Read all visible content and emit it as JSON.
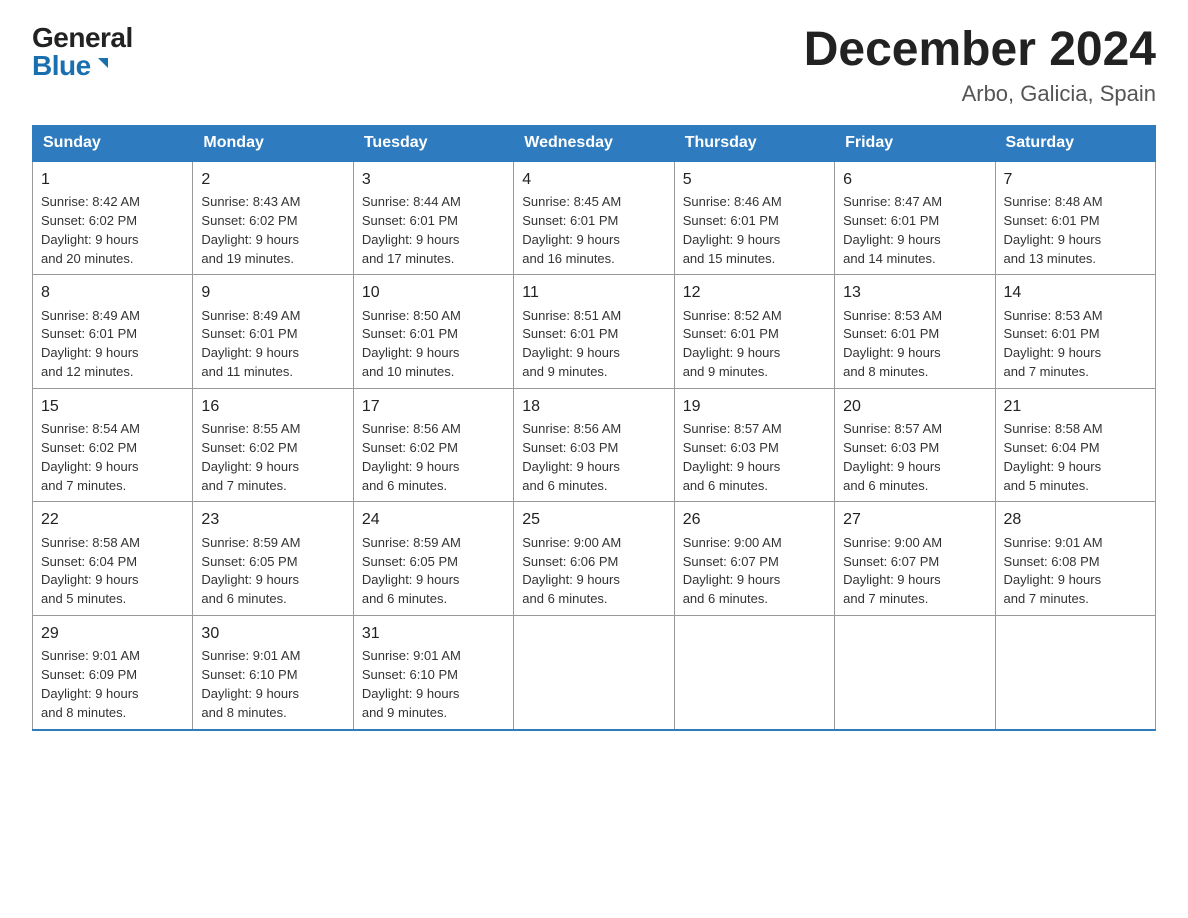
{
  "logo": {
    "general": "General",
    "blue": "Blue"
  },
  "title": "December 2024",
  "subtitle": "Arbo, Galicia, Spain",
  "days_of_week": [
    "Sunday",
    "Monday",
    "Tuesday",
    "Wednesday",
    "Thursday",
    "Friday",
    "Saturday"
  ],
  "weeks": [
    [
      {
        "day": "1",
        "info": "Sunrise: 8:42 AM\nSunset: 6:02 PM\nDaylight: 9 hours\nand 20 minutes."
      },
      {
        "day": "2",
        "info": "Sunrise: 8:43 AM\nSunset: 6:02 PM\nDaylight: 9 hours\nand 19 minutes."
      },
      {
        "day": "3",
        "info": "Sunrise: 8:44 AM\nSunset: 6:01 PM\nDaylight: 9 hours\nand 17 minutes."
      },
      {
        "day": "4",
        "info": "Sunrise: 8:45 AM\nSunset: 6:01 PM\nDaylight: 9 hours\nand 16 minutes."
      },
      {
        "day": "5",
        "info": "Sunrise: 8:46 AM\nSunset: 6:01 PM\nDaylight: 9 hours\nand 15 minutes."
      },
      {
        "day": "6",
        "info": "Sunrise: 8:47 AM\nSunset: 6:01 PM\nDaylight: 9 hours\nand 14 minutes."
      },
      {
        "day": "7",
        "info": "Sunrise: 8:48 AM\nSunset: 6:01 PM\nDaylight: 9 hours\nand 13 minutes."
      }
    ],
    [
      {
        "day": "8",
        "info": "Sunrise: 8:49 AM\nSunset: 6:01 PM\nDaylight: 9 hours\nand 12 minutes."
      },
      {
        "day": "9",
        "info": "Sunrise: 8:49 AM\nSunset: 6:01 PM\nDaylight: 9 hours\nand 11 minutes."
      },
      {
        "day": "10",
        "info": "Sunrise: 8:50 AM\nSunset: 6:01 PM\nDaylight: 9 hours\nand 10 minutes."
      },
      {
        "day": "11",
        "info": "Sunrise: 8:51 AM\nSunset: 6:01 PM\nDaylight: 9 hours\nand 9 minutes."
      },
      {
        "day": "12",
        "info": "Sunrise: 8:52 AM\nSunset: 6:01 PM\nDaylight: 9 hours\nand 9 minutes."
      },
      {
        "day": "13",
        "info": "Sunrise: 8:53 AM\nSunset: 6:01 PM\nDaylight: 9 hours\nand 8 minutes."
      },
      {
        "day": "14",
        "info": "Sunrise: 8:53 AM\nSunset: 6:01 PM\nDaylight: 9 hours\nand 7 minutes."
      }
    ],
    [
      {
        "day": "15",
        "info": "Sunrise: 8:54 AM\nSunset: 6:02 PM\nDaylight: 9 hours\nand 7 minutes."
      },
      {
        "day": "16",
        "info": "Sunrise: 8:55 AM\nSunset: 6:02 PM\nDaylight: 9 hours\nand 7 minutes."
      },
      {
        "day": "17",
        "info": "Sunrise: 8:56 AM\nSunset: 6:02 PM\nDaylight: 9 hours\nand 6 minutes."
      },
      {
        "day": "18",
        "info": "Sunrise: 8:56 AM\nSunset: 6:03 PM\nDaylight: 9 hours\nand 6 minutes."
      },
      {
        "day": "19",
        "info": "Sunrise: 8:57 AM\nSunset: 6:03 PM\nDaylight: 9 hours\nand 6 minutes."
      },
      {
        "day": "20",
        "info": "Sunrise: 8:57 AM\nSunset: 6:03 PM\nDaylight: 9 hours\nand 6 minutes."
      },
      {
        "day": "21",
        "info": "Sunrise: 8:58 AM\nSunset: 6:04 PM\nDaylight: 9 hours\nand 5 minutes."
      }
    ],
    [
      {
        "day": "22",
        "info": "Sunrise: 8:58 AM\nSunset: 6:04 PM\nDaylight: 9 hours\nand 5 minutes."
      },
      {
        "day": "23",
        "info": "Sunrise: 8:59 AM\nSunset: 6:05 PM\nDaylight: 9 hours\nand 6 minutes."
      },
      {
        "day": "24",
        "info": "Sunrise: 8:59 AM\nSunset: 6:05 PM\nDaylight: 9 hours\nand 6 minutes."
      },
      {
        "day": "25",
        "info": "Sunrise: 9:00 AM\nSunset: 6:06 PM\nDaylight: 9 hours\nand 6 minutes."
      },
      {
        "day": "26",
        "info": "Sunrise: 9:00 AM\nSunset: 6:07 PM\nDaylight: 9 hours\nand 6 minutes."
      },
      {
        "day": "27",
        "info": "Sunrise: 9:00 AM\nSunset: 6:07 PM\nDaylight: 9 hours\nand 7 minutes."
      },
      {
        "day": "28",
        "info": "Sunrise: 9:01 AM\nSunset: 6:08 PM\nDaylight: 9 hours\nand 7 minutes."
      }
    ],
    [
      {
        "day": "29",
        "info": "Sunrise: 9:01 AM\nSunset: 6:09 PM\nDaylight: 9 hours\nand 8 minutes."
      },
      {
        "day": "30",
        "info": "Sunrise: 9:01 AM\nSunset: 6:10 PM\nDaylight: 9 hours\nand 8 minutes."
      },
      {
        "day": "31",
        "info": "Sunrise: 9:01 AM\nSunset: 6:10 PM\nDaylight: 9 hours\nand 9 minutes."
      },
      {
        "day": "",
        "info": ""
      },
      {
        "day": "",
        "info": ""
      },
      {
        "day": "",
        "info": ""
      },
      {
        "day": "",
        "info": ""
      }
    ]
  ]
}
